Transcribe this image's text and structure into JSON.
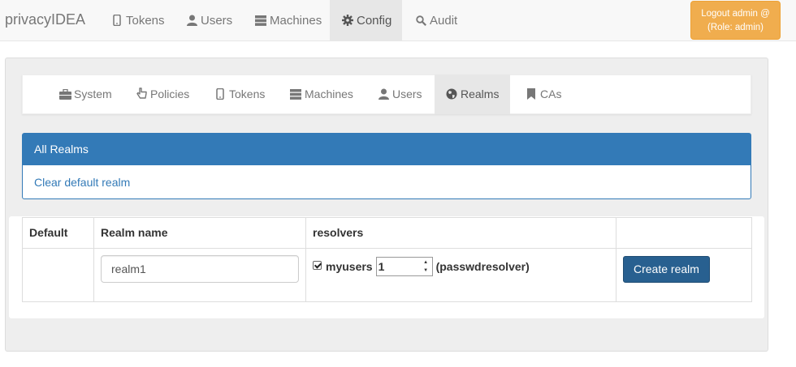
{
  "app": {
    "brand": "privacyIDEA"
  },
  "topnav": {
    "items": [
      {
        "label": "Tokens",
        "icon": "mobile-icon"
      },
      {
        "label": "Users",
        "icon": "user-icon"
      },
      {
        "label": "Machines",
        "icon": "server-icon"
      },
      {
        "label": "Config",
        "icon": "gear-icon",
        "active": true
      },
      {
        "label": "Audit",
        "icon": "search-icon"
      }
    ],
    "logout_line1": "Logout admin @",
    "logout_line2": "(Role: admin)"
  },
  "config_nav": {
    "items": [
      {
        "label": "System",
        "icon": "briefcase-icon"
      },
      {
        "label": "Policies",
        "icon": "hand-pointer-icon"
      },
      {
        "label": "Tokens",
        "icon": "mobile-icon"
      },
      {
        "label": "Machines",
        "icon": "server-icon"
      },
      {
        "label": "Users",
        "icon": "user-icon"
      },
      {
        "label": "Realms",
        "icon": "globe-icon",
        "active": true
      },
      {
        "label": "CAs",
        "icon": "bookmark-icon"
      }
    ]
  },
  "realms_panel": {
    "heading": "All Realms",
    "clear_default": "Clear default realm"
  },
  "realm_table": {
    "headers": [
      "Default",
      "Realm name",
      "resolvers",
      ""
    ],
    "new_realm_value": "realm1",
    "resolver": {
      "checked": true,
      "name": "myusers",
      "priority": "1",
      "type": "(passwdresolver)"
    },
    "create_button": "Create realm"
  },
  "colors": {
    "primary": "#337ab7",
    "button_dark": "#286090",
    "warning": "#f0ad4e",
    "navbar_bg": "#f8f8f8"
  }
}
